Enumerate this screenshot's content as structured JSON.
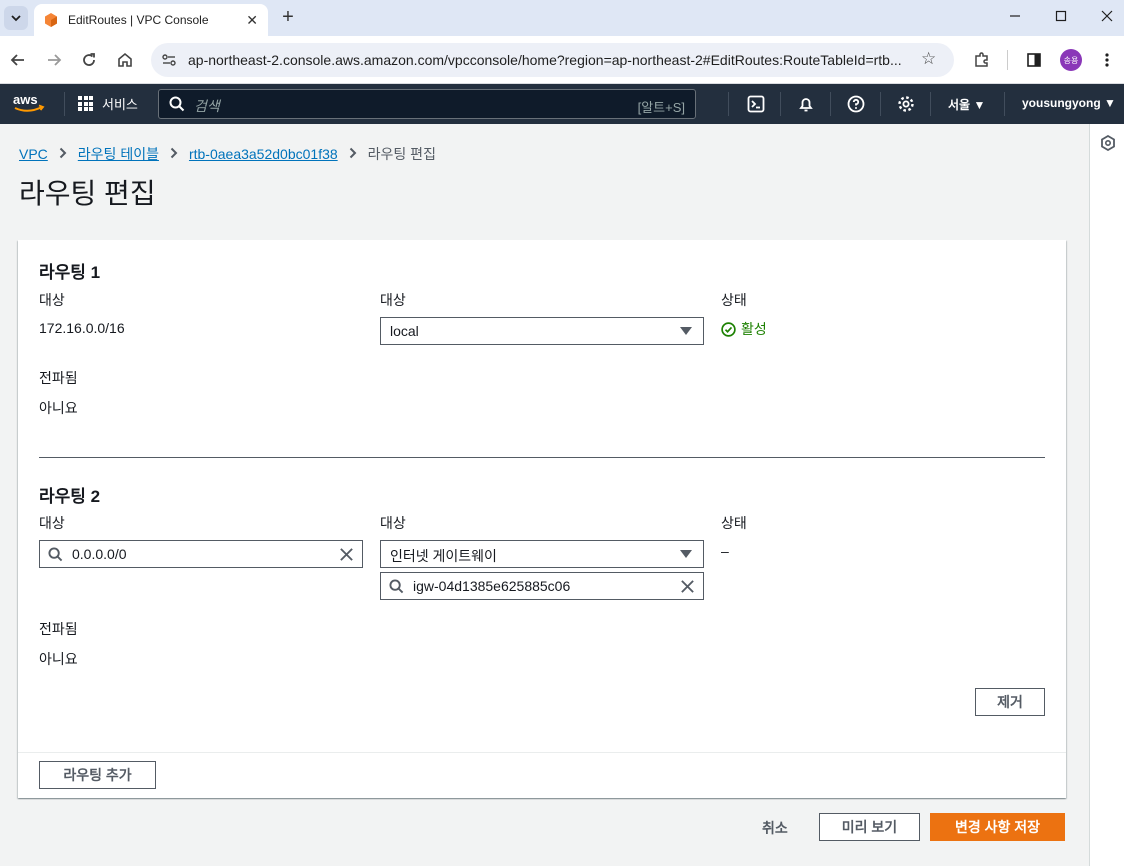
{
  "browser": {
    "tab_title": "EditRoutes | VPC Console",
    "url": "ap-northeast-2.console.aws.amazon.com/vpcconsole/home?region=ap-northeast-2#EditRoutes:RouteTableId=rtb...",
    "profile_initials": "송용"
  },
  "aws_nav": {
    "logo": "aws",
    "services_label": "서비스",
    "search_placeholder": "검색",
    "search_shortcut": "[알트+S]",
    "region": "서울",
    "user": "yousungyong"
  },
  "breadcrumb": {
    "items": [
      "VPC",
      "라우팅 테이블",
      "rtb-0aea3a52d0bc01f38"
    ],
    "current": "라우팅 편집"
  },
  "page_title": "라우팅 편집",
  "routes": [
    {
      "heading": "라우팅 1",
      "destination_label": "대상",
      "destination_value": "172.16.0.0/16",
      "target_label": "대상",
      "target_value": "local",
      "status_label": "상태",
      "status_value": "활성",
      "propagated_label": "전파됨",
      "propagated_value": "아니요"
    },
    {
      "heading": "라우팅 2",
      "destination_label": "대상",
      "destination_value": "0.0.0.0/0",
      "target_label": "대상",
      "target_value": "인터넷 게이트웨이",
      "target_search_value": "igw-04d1385e625885c06",
      "status_label": "상태",
      "status_value": "–",
      "propagated_label": "전파됨",
      "propagated_value": "아니요",
      "remove_label": "제거"
    }
  ],
  "add_route_label": "라우팅 추가",
  "actions": {
    "cancel": "취소",
    "preview": "미리 보기",
    "save": "변경 사항 저장"
  },
  "colors": {
    "aws_nav_bg": "#232f3e",
    "primary": "#ec7211",
    "link": "#0073bb",
    "success": "#1d8102"
  }
}
